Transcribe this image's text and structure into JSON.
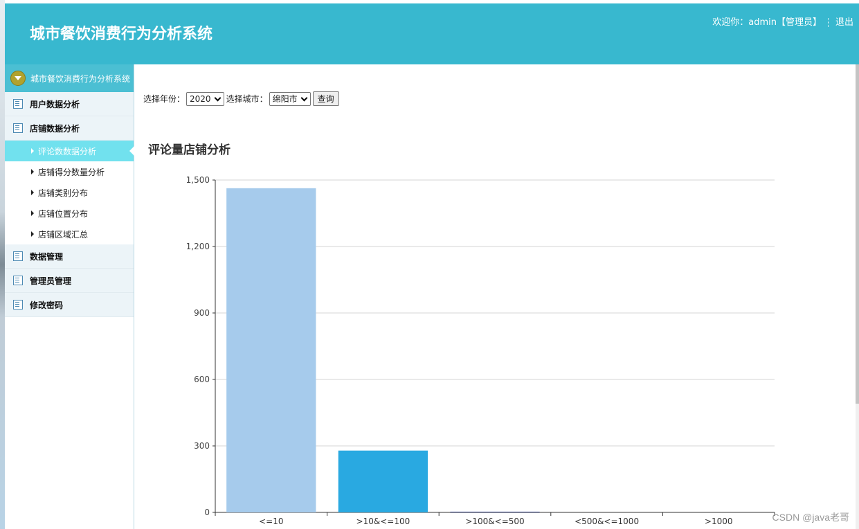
{
  "header": {
    "system_title": "城市餐饮消费行为分析系统",
    "welcome_text": "欢迎你：admin【管理员】",
    "logout_label": "退出"
  },
  "sidebar": {
    "head_label": "城市餐饮消费行为分析系统",
    "groups": [
      {
        "label": "用户数据分析"
      },
      {
        "label": "店铺数据分析",
        "items": [
          "评论数数据分析",
          "店铺得分数量分析",
          "店铺类别分布",
          "店铺位置分布",
          "店铺区域汇总"
        ]
      },
      {
        "label": "数据管理"
      },
      {
        "label": "管理员管理"
      },
      {
        "label": "修改密码"
      }
    ],
    "active_item": "评论数数据分析"
  },
  "filters": {
    "year_label": "选择年份：",
    "year_value": "2020",
    "city_label": "选择城市：",
    "city_value": "绵阳市",
    "query_label": "查询"
  },
  "watermark": "CSDN @java老哥",
  "chart_data": {
    "type": "bar",
    "title": "评论量店铺分析",
    "categories": [
      "<=10",
      ">10&<=100",
      ">100&<=500",
      "<500&<=1000",
      ">1000"
    ],
    "values": [
      1463,
      279,
      3,
      0,
      0
    ],
    "bar_colors": [
      "#a6cbec",
      "#29a9e1",
      "#2a3a8a",
      "#2a3a8a",
      "#2a3a8a"
    ],
    "ylim": [
      0,
      1500
    ],
    "yticks": [
      0,
      300,
      600,
      900,
      1200,
      1500
    ],
    "ytick_labels": [
      "0",
      "300",
      "600",
      "900",
      "1,200",
      "1,500"
    ],
    "grid": true
  }
}
